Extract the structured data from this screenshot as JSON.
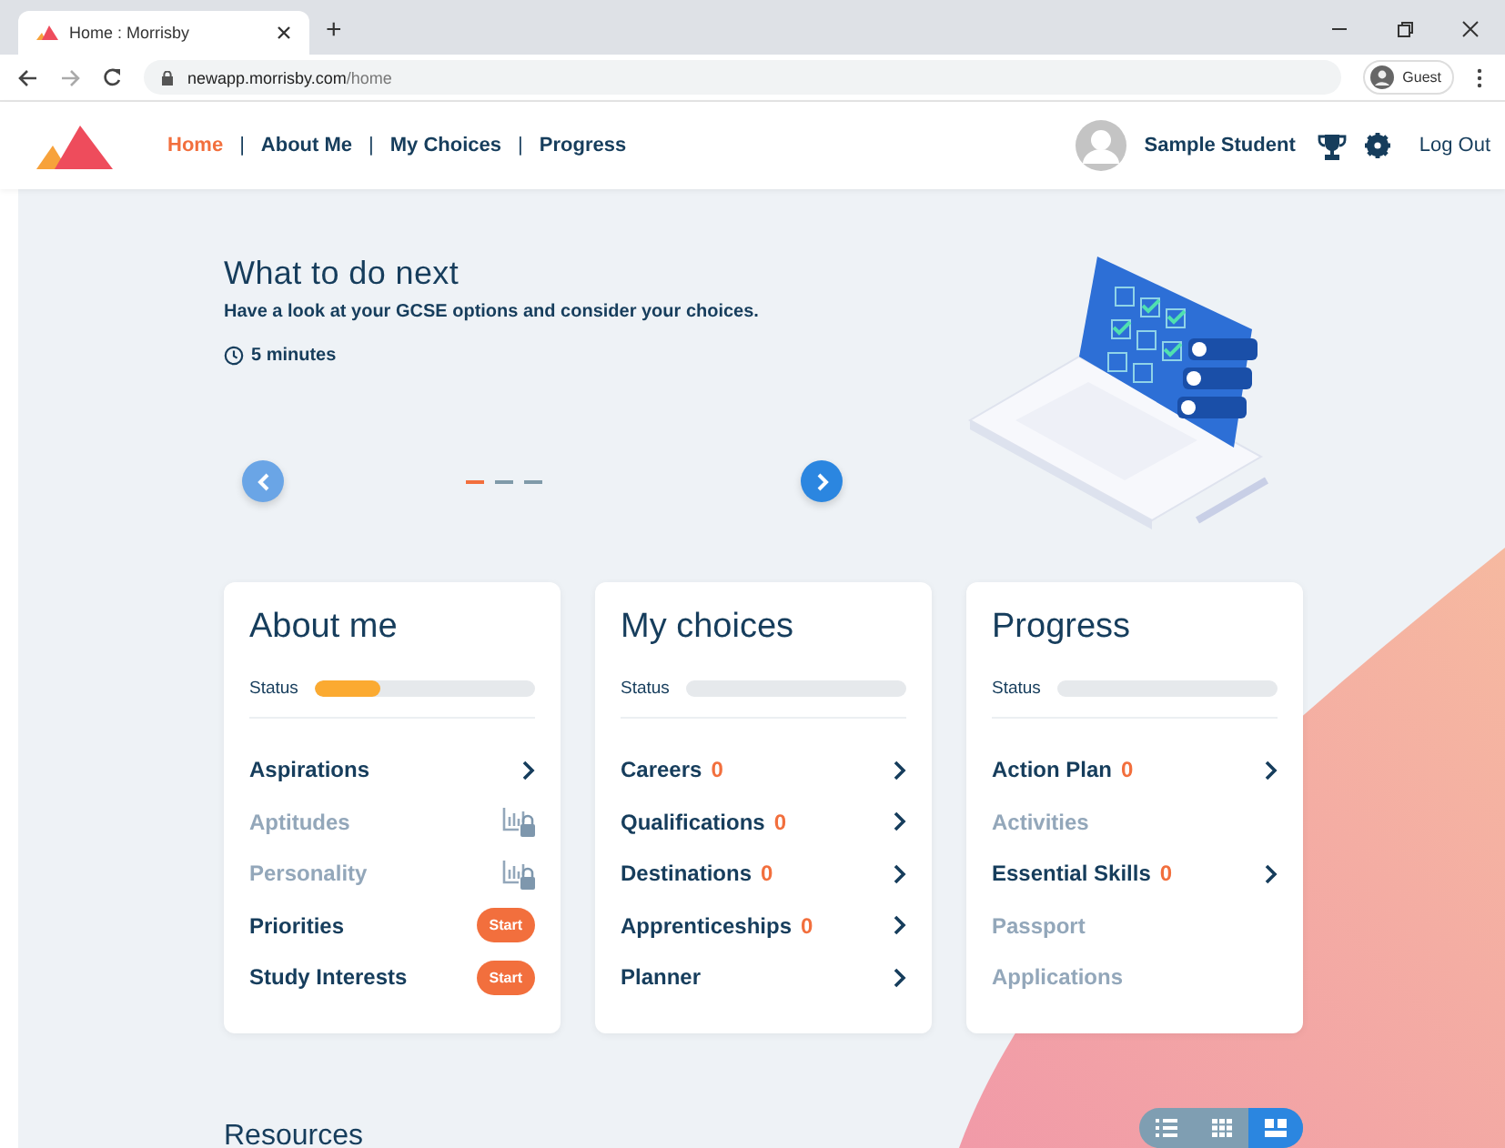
{
  "browser": {
    "tab_title": "Home : Morrisby",
    "new_tab": "+",
    "url_host": "newapp.morrisby.com",
    "url_path": "/home",
    "profile": "Guest"
  },
  "nav": {
    "links": [
      {
        "label": "Home",
        "selected": true
      },
      {
        "label": "About Me",
        "selected": false
      },
      {
        "label": "My Choices",
        "selected": false
      },
      {
        "label": "Progress",
        "selected": false
      }
    ],
    "separator": "|",
    "user_name": "Sample Student",
    "logout": "Log Out"
  },
  "hero": {
    "title": "What to do next",
    "subtitle": "Have a look at your GCSE options and consider your choices.",
    "duration": "5 minutes",
    "slides": [
      {
        "selected": true
      },
      {
        "selected": false
      },
      {
        "selected": false
      }
    ]
  },
  "cards": [
    {
      "title": "About me",
      "status_label": "Status",
      "level": 0.3,
      "items": [
        {
          "label": "Aspirations",
          "disabled": false,
          "kind": "arrow"
        },
        {
          "label": "Aptitudes",
          "disabled": true,
          "kind": "locked"
        },
        {
          "label": "Personality",
          "disabled": true,
          "kind": "locked"
        },
        {
          "label": "Priorities",
          "disabled": false,
          "kind": "start",
          "action": "Start"
        },
        {
          "label": "Study Interests",
          "disabled": false,
          "kind": "start",
          "action": "Start"
        }
      ]
    },
    {
      "title": "My choices",
      "status_label": "Status",
      "level": 0,
      "items": [
        {
          "label": "Careers",
          "count": "0",
          "disabled": false,
          "kind": "arrow"
        },
        {
          "label": "Qualifications",
          "count": "0",
          "disabled": false,
          "kind": "arrow"
        },
        {
          "label": "Destinations",
          "count": "0",
          "disabled": false,
          "kind": "arrow"
        },
        {
          "label": "Apprenticeships",
          "count": "0",
          "disabled": false,
          "kind": "arrow"
        },
        {
          "label": "Planner",
          "disabled": false,
          "kind": "arrow"
        }
      ]
    },
    {
      "title": "Progress",
      "status_label": "Status",
      "level": 0,
      "items": [
        {
          "label": "Action Plan",
          "count": "0",
          "disabled": false,
          "kind": "arrow"
        },
        {
          "label": "Activities",
          "disabled": true,
          "kind": "none"
        },
        {
          "label": "Essential Skills",
          "count": "0",
          "disabled": false,
          "kind": "arrow"
        },
        {
          "label": "Passport",
          "disabled": true,
          "kind": "none"
        },
        {
          "label": "Applications",
          "disabled": true,
          "kind": "none"
        }
      ]
    }
  ],
  "resources": {
    "title": "Resources",
    "views": [
      {
        "kind": "list",
        "selected": false
      },
      {
        "kind": "grid",
        "selected": false
      },
      {
        "kind": "tiles",
        "selected": true
      }
    ]
  }
}
